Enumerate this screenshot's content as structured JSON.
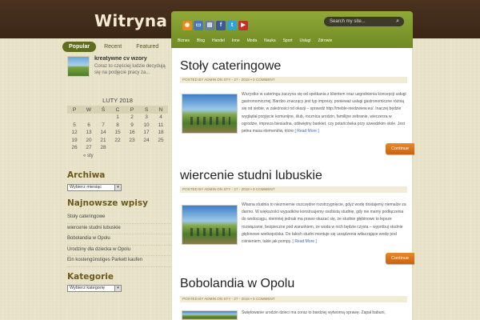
{
  "site": {
    "title": "Witryna"
  },
  "left_tabs": [
    "Popular",
    "Recent",
    "Featured"
  ],
  "popular_post": {
    "title": "kreatywne cv wzory",
    "excerpt": "Coraz to częściej ludzie decydują się na podjęcie pracy za..."
  },
  "calendar": {
    "caption": "LUTY 2018",
    "headers": [
      "P",
      "W",
      "Ś",
      "C",
      "P",
      "S",
      "N"
    ],
    "rows": [
      [
        "",
        "",
        "",
        "1",
        "2",
        "3",
        "4"
      ],
      [
        "5",
        "6",
        "7",
        "8",
        "9",
        "10",
        "11"
      ],
      [
        "12",
        "13",
        "14",
        "15",
        "16",
        "17",
        "18"
      ],
      [
        "19",
        "20",
        "21",
        "22",
        "23",
        "24",
        "25"
      ],
      [
        "26",
        "27",
        "28",
        "",
        "",
        "",
        ""
      ]
    ],
    "prev_link": "« sty"
  },
  "archive": {
    "title": "Archiwa",
    "select_value": "Wybierz miesiąc"
  },
  "recent": {
    "title": "Najnowsze wpisy",
    "items": [
      "Stoły cateringowe",
      "wiercenie studni lubuskie",
      "Bobolandia w Opolu",
      "Urodziny dla dziecka w Opolu",
      "Ein kostengünstiges Parkett kaufen"
    ]
  },
  "categories": {
    "title": "Kategorie",
    "select_value": "Wybierz kategorię"
  },
  "search": {
    "placeholder": "Search my site..."
  },
  "social_icons": [
    {
      "name": "rss-icon",
      "glyph": "◉",
      "color": "#e98a1e"
    },
    {
      "name": "monitor-icon",
      "glyph": "▭",
      "color": "#4a78b5"
    },
    {
      "name": "print-icon",
      "glyph": "▤",
      "color": "#6a7fa0"
    },
    {
      "name": "facebook-icon",
      "glyph": "f",
      "color": "#3b5998"
    },
    {
      "name": "twitter-icon",
      "glyph": "t",
      "color": "#2fa3d8"
    },
    {
      "name": "youtube-icon",
      "glyph": "▶",
      "color": "#c4302b"
    }
  ],
  "nav": [
    "Biznes",
    "Blog",
    "Handel",
    "Inne",
    "Moda",
    "Nauka",
    "Sport",
    "Usługi",
    "Zdrowie"
  ],
  "posts": [
    {
      "title": "Stoły cateringowe",
      "meta": "POSTED BY ADMIN ON STY - 27 - 2018 • 0 COMMENT",
      "excerpt": "Wszystko w cateringu zaczyna się od spotkania z klientem oraz uzgodnienia koncepcji usługi gastronomicznej. Bardzo znaczący jest typ imprezy, ponieważ usługi gastronomiczne różnią się od siebie, w zależności od okazji – sprawdź http://meble-niedzwiew.eu/. Inaczej będzie wyglądał przyjęcie komunijne, ślub, rocznica urodzin, familijne zebranie, wieczerza w ogrodzie, impreza biesiadna, odświętny bankiet, czy potańcówka przy szwedzkim stole. Jest pełna masa elementów, które",
      "more": "[ Read More ]",
      "button": "Continue"
    },
    {
      "title": "wiercenie studni lubuskie",
      "meta": "POSTED BY ADMIN ON STY - 27 - 2018 • 0 COMMENT",
      "excerpt": "Własna studnia to niezmiernie oszczędne rozstrzygnięcie, gdyż wodę dostajemy niemalże za darmo. W większości wypadków konstruujemy osobistą studnię, gdy nie mamy podłączenia do wodociągu, niemniej jednak ma prawo okazać się, że studnie głębinowe to lepsze rozwiązanie, bezpieczne pod warunkiem, że woda w nich będzie czysta – wypróbuj studnie głębinowe wielkopolska. Do takich studni montuje się urządzenia wtłaczające wodę pod ciśnieniem, takie jak pompy.",
      "more": "[ Read More ]",
      "button": "Continue"
    },
    {
      "title": "Bobolandia w Opolu",
      "meta": "POSTED BY ADMIN ON STY - 27 - 2018 • 0 COMMENT",
      "excerpt": "Świętowanie urodzin dzieci ma coraz to bardziej wytworną oprawę. Zapał babuni,"
    }
  ]
}
